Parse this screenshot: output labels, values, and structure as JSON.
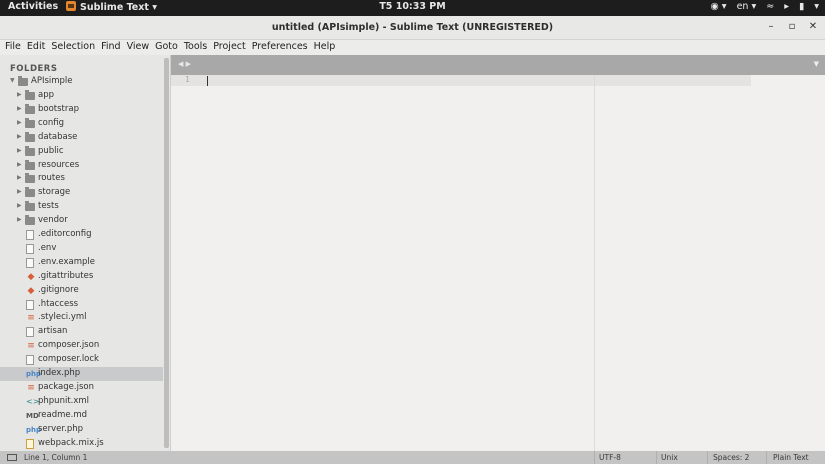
{
  "topbar": {
    "activities": "Activities",
    "app_name": "Sublime Text",
    "clock": "T5 10:33 PM",
    "lang": "en"
  },
  "window": {
    "title": "untitled (APIsimple) - Sublime Text (UNREGISTERED)"
  },
  "menu": [
    "File",
    "Edit",
    "Selection",
    "Find",
    "View",
    "Goto",
    "Tools",
    "Project",
    "Preferences",
    "Help"
  ],
  "sidebar": {
    "header": "FOLDERS",
    "root": "APIsimple",
    "items": [
      {
        "label": "app",
        "kind": "folder-icon"
      },
      {
        "label": "bootstrap",
        "kind": "folder-icon"
      },
      {
        "label": "config",
        "kind": "folder-icon"
      },
      {
        "label": "database",
        "kind": "folder-icon"
      },
      {
        "label": "public",
        "kind": "folder-icon"
      },
      {
        "label": "resources",
        "kind": "folder-icon"
      },
      {
        "label": "routes",
        "kind": "folder-icon"
      },
      {
        "label": "storage",
        "kind": "folder-icon"
      },
      {
        "label": "tests",
        "kind": "folder-icon"
      },
      {
        "label": "vendor",
        "kind": "folder-icon"
      },
      {
        "label": ".editorconfig",
        "kind": "file-icon"
      },
      {
        "label": ".env",
        "kind": "file-icon"
      },
      {
        "label": ".env.example",
        "kind": "file-icon"
      },
      {
        "label": ".gitattributes",
        "kind": "git-icon"
      },
      {
        "label": ".gitignore",
        "kind": "git-icon"
      },
      {
        "label": ".htaccess",
        "kind": "file-icon"
      },
      {
        "label": ".styleci.yml",
        "kind": "db-icon"
      },
      {
        "label": "artisan",
        "kind": "lines-icon"
      },
      {
        "label": "composer.json",
        "kind": "db-icon"
      },
      {
        "label": "composer.lock",
        "kind": "file-icon"
      },
      {
        "label": "index.php",
        "kind": "php-icon",
        "selected": true
      },
      {
        "label": "package.json",
        "kind": "db-icon"
      },
      {
        "label": "phpunit.xml",
        "kind": "xml-icon"
      },
      {
        "label": "readme.md",
        "kind": "md-icon"
      },
      {
        "label": "server.php",
        "kind": "php-icon"
      },
      {
        "label": "webpack.mix.js",
        "kind": "js-icon"
      }
    ]
  },
  "editor": {
    "line_number": "1"
  },
  "status": {
    "position": "Line 1, Column 1",
    "encoding": "UTF-8",
    "line_endings": "Unix",
    "indentation": "Spaces: 2",
    "syntax": "Plain Text"
  }
}
